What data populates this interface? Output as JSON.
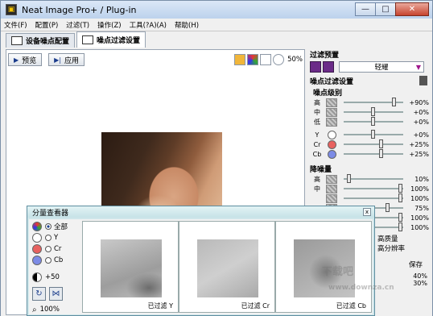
{
  "window": {
    "title": "Neat Image Pro+ / Plug-in",
    "min": "—",
    "max": "□",
    "close": "✕"
  },
  "menu": [
    "文件(F)",
    "配置(P)",
    "过滤(T)",
    "操作(Z)",
    "工具(?A)(A)",
    "帮助(H)"
  ],
  "tabs": [
    {
      "label": "设备噪点配置"
    },
    {
      "label": "噪点过滤设置"
    }
  ],
  "toolbar": {
    "preview_label": "预览",
    "apply_label": "应用",
    "zoom": "50%"
  },
  "right": {
    "preset_title": "过滤预置",
    "preset_value": "轻耀",
    "filter_settings_title": "噪点过滤设置",
    "noise_level_title": "噪点级别",
    "levels": [
      {
        "label": "高",
        "value": "+90%"
      },
      {
        "label": "中",
        "value": "+0%"
      },
      {
        "label": "低",
        "value": "+0%"
      }
    ],
    "channels": [
      {
        "label": "Y",
        "value": "+0%"
      },
      {
        "label": "Cr",
        "value": "+25%"
      },
      {
        "label": "Cb",
        "value": "+25%"
      }
    ],
    "reduction_title": "降噪量",
    "reduction": [
      {
        "label": "高",
        "value": "10%"
      },
      {
        "label": "中",
        "value": "100%"
      },
      {
        "label": "",
        "value": "100%"
      },
      {
        "label": "",
        "value": "75%"
      },
      {
        "label": "",
        "value": "100%"
      },
      {
        "label": "",
        "value": "100%"
      }
    ],
    "extra_labels": [
      "高质量",
      "高分辨率"
    ],
    "save_label": "保存",
    "bottom_values": [
      "40%",
      "30%"
    ]
  },
  "dialog": {
    "title": "分量查看器",
    "close": "x",
    "options": [
      {
        "label": "全部",
        "selected": true
      },
      {
        "label": "Y",
        "selected": false
      },
      {
        "label": "Cr",
        "selected": false
      },
      {
        "label": "Cb",
        "selected": false
      }
    ],
    "contrast": "+50",
    "zoom": "100%",
    "panes": [
      {
        "caption": "已过滤 Y"
      },
      {
        "caption": "已过滤 Cr"
      },
      {
        "caption": "已过滤 Cb"
      }
    ]
  },
  "watermark": {
    "line1": "下载吧",
    "line2": "www.downza.cn"
  }
}
